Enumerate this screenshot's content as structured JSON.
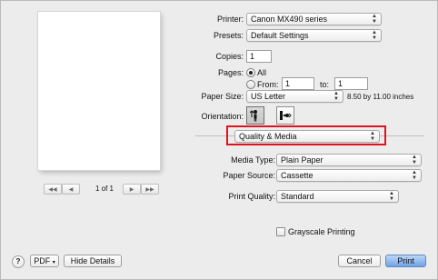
{
  "preview": {
    "page_indicator": "1 of 1"
  },
  "settings": {
    "printer_label": "Printer:",
    "printer_value": "Canon MX490 series",
    "presets_label": "Presets:",
    "presets_value": "Default Settings",
    "copies_label": "Copies:",
    "copies_value": "1",
    "pages_label": "Pages:",
    "all_label": "All",
    "from_label": "From:",
    "from_value": "1",
    "to_label": "to:",
    "to_value": "1",
    "paper_size_label": "Paper Size:",
    "paper_size_value": "US Letter",
    "paper_size_dimensions": "8.50 by 11.00 inches",
    "orientation_label": "Orientation:",
    "section_value": "Quality & Media",
    "media_type_label": "Media Type:",
    "media_type_value": "Plain Paper",
    "paper_source_label": "Paper Source:",
    "paper_source_value": "Cassette",
    "print_quality_label": "Print Quality:",
    "print_quality_value": "Standard",
    "grayscale_label": "Grayscale Printing"
  },
  "footer": {
    "help_label": "?",
    "pdf_label": "PDF",
    "hide_details_label": "Hide Details",
    "cancel_label": "Cancel",
    "print_label": "Print"
  },
  "colors": {
    "highlight_border": "#e0141e",
    "print_button": "#6ea2e6"
  },
  "icons": {
    "popup_arrows": "up-down-arrows-icon",
    "orientation_portrait": "portrait-orientation-icon",
    "orientation_landscape": "landscape-orientation-icon"
  }
}
